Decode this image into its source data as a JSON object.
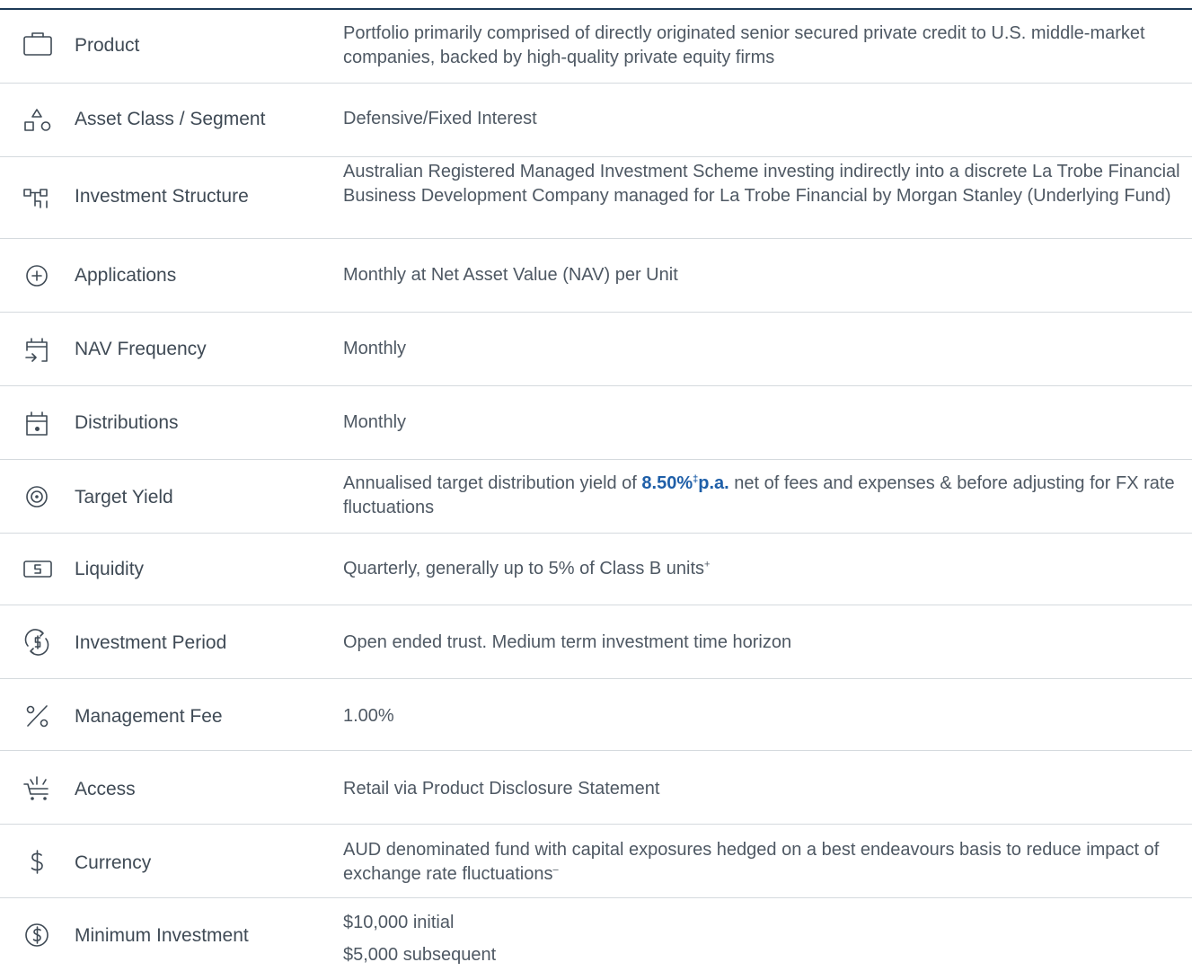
{
  "rows": [
    {
      "icon": "briefcase-icon",
      "label": "Product",
      "value": "Portfolio primarily comprised of directly originated senior secured private credit to U.S. middle-market companies, backed by high-quality private equity firms"
    },
    {
      "icon": "shapes-icon",
      "label": "Asset Class / Segment",
      "value": "Defensive/Fixed Interest"
    },
    {
      "icon": "org-structure-icon",
      "label": "Investment Structure",
      "value": "Australian Registered Managed Investment Scheme investing indirectly into a discrete La Trobe Financial Business Development Company managed for La Trobe Financial by Morgan Stanley (Underlying Fund)"
    },
    {
      "icon": "plus-circle-icon",
      "label": "Applications",
      "value": "Monthly at Net Asset Value (NAV) per Unit"
    },
    {
      "icon": "calendar-arrow-icon",
      "label": "NAV Frequency",
      "value": "Monthly"
    },
    {
      "icon": "calendar-dot-icon",
      "label": "Distributions",
      "value": "Monthly"
    },
    {
      "icon": "target-icon",
      "label": "Target Yield",
      "value_pre": "Annualised target distribution yield of ",
      "value_highlight": "8.50%",
      "value_highlight_sup": "‡",
      "value_highlight_post": "p.a.",
      "value_post": " net of fees and expenses & before adjusting for FX rate fluctuations"
    },
    {
      "icon": "cash-note-icon",
      "label": "Liquidity",
      "value": "Quarterly, generally up to 5% of Class B units",
      "value_sup": "+"
    },
    {
      "icon": "dollar-cycle-icon",
      "label": "Investment Period",
      "value": "Open ended trust.  Medium term investment time horizon"
    },
    {
      "icon": "percent-icon",
      "label": "Management Fee",
      "value": "1.00%"
    },
    {
      "icon": "cart-icon",
      "label": "Access",
      "value": "Retail via Product Disclosure Statement"
    },
    {
      "icon": "dollar-icon",
      "label": "Currency",
      "value": "AUD denominated fund with capital exposures hedged on a best endeavours basis to reduce impact of exchange rate fluctuations",
      "value_sup": "–"
    },
    {
      "icon": "dollar-circle-icon",
      "label": "Minimum Investment",
      "value_line1": "$10,000 initial",
      "value_line2": "$5,000 subsequent"
    }
  ],
  "colors": {
    "rule": "#1d3a57",
    "divider": "#d5dade",
    "text": "#3f4a55",
    "highlight": "#1f5fa8"
  }
}
